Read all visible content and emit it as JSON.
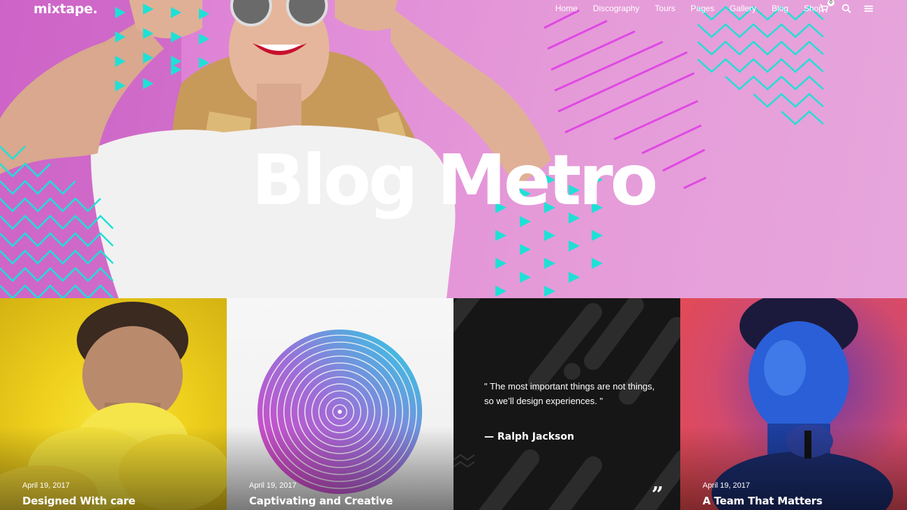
{
  "header": {
    "logo": "mixtape.",
    "nav": [
      "Home",
      "Discography",
      "Tours",
      "Pages",
      "Gallery",
      "Blog",
      "Shop"
    ],
    "cart_count": "0",
    "icons": [
      "cart-icon",
      "search-icon",
      "menu-icon"
    ]
  },
  "hero": {
    "title": "Blog Metro"
  },
  "tiles": [
    {
      "date": "April 19, 2017",
      "title": "Designed With care"
    },
    {
      "date": "April 19, 2017",
      "title": "Captivating and Creative"
    },
    {
      "quote": "\" The most important things are not things, so we’ll design experiences. \"",
      "author": "— Ralph Jackson"
    },
    {
      "date": "April 19, 2017",
      "title": "A Team That Matters"
    }
  ],
  "colors": {
    "hero_pink": "#e08ad8",
    "accent_teal": "#1fe0d6",
    "accent_magenta": "#e040e6",
    "tile_yellow": "#f0d21e",
    "tile_dark": "#161616"
  }
}
